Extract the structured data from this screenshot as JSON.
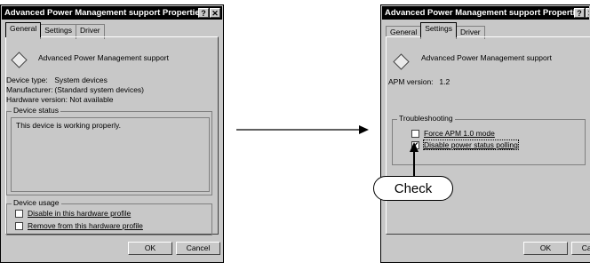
{
  "left_window": {
    "title": "Advanced Power Management support Properties",
    "help_button": "?",
    "close_button": "✕",
    "tabs": [
      {
        "label": "General",
        "active": true
      },
      {
        "label": "Settings",
        "active": false
      },
      {
        "label": "Driver",
        "active": false
      }
    ],
    "device_name": "Advanced Power Management support",
    "device_type_label": "Device type:",
    "device_type_value": "System devices",
    "manufacturer_label": "Manufacturer:",
    "manufacturer_value": "(Standard system devices)",
    "hardware_version_label": "Hardware version:",
    "hardware_version_value": "Not available",
    "device_status_legend": "Device status",
    "device_status_text": "This device is working properly.",
    "device_usage_legend": "Device usage",
    "usage_options": [
      {
        "label": "Disable in this hardware profile",
        "checked": false
      },
      {
        "label": "Remove from this hardware profile",
        "checked": false
      }
    ],
    "ok_label": "OK",
    "cancel_label": "Cancel"
  },
  "right_window": {
    "title": "Advanced Power Management support Properties",
    "help_button": "?",
    "close_button": "✕",
    "tabs": [
      {
        "label": "General",
        "active": false
      },
      {
        "label": "Settings",
        "active": true
      },
      {
        "label": "Driver",
        "active": false
      }
    ],
    "device_name": "Advanced Power Management support",
    "apm_version_label": "APM version:",
    "apm_version_value": "1.2",
    "troubleshooting_legend": "Troubleshooting",
    "options": [
      {
        "label": "Force APM 1.0 mode",
        "checked": false
      },
      {
        "label": "Disable power status polling",
        "checked": true
      }
    ],
    "ok_label": "OK",
    "cancel_label": "Cancel"
  },
  "annotation": {
    "callout_text": "Check"
  },
  "glyphs": {
    "checkmark": "✔"
  }
}
